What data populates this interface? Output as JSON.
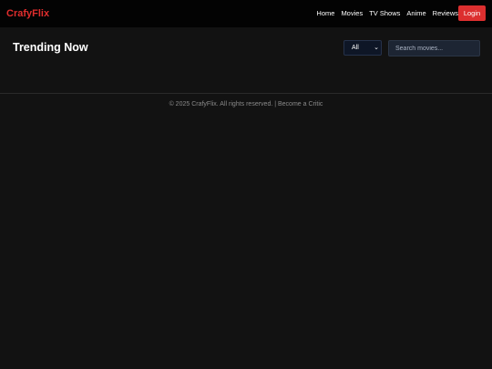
{
  "navbar": {
    "brand": "CrafyFlix",
    "links": [
      "Home",
      "Movies",
      "TV Shows",
      "Anime",
      "Reviews"
    ],
    "login_label": "Login"
  },
  "main": {
    "title": "Trending Now",
    "filter": {
      "selected": "All"
    },
    "search": {
      "placeholder": "Search movies..."
    }
  },
  "footer": {
    "copyright": "© 2025 CrafyFlix. All rights reserved.",
    "separator": " | ",
    "critic_link": "Become a Critic"
  },
  "colors": {
    "accent": "#dc2f2f",
    "background": "#121212",
    "navbar": "#030303"
  }
}
